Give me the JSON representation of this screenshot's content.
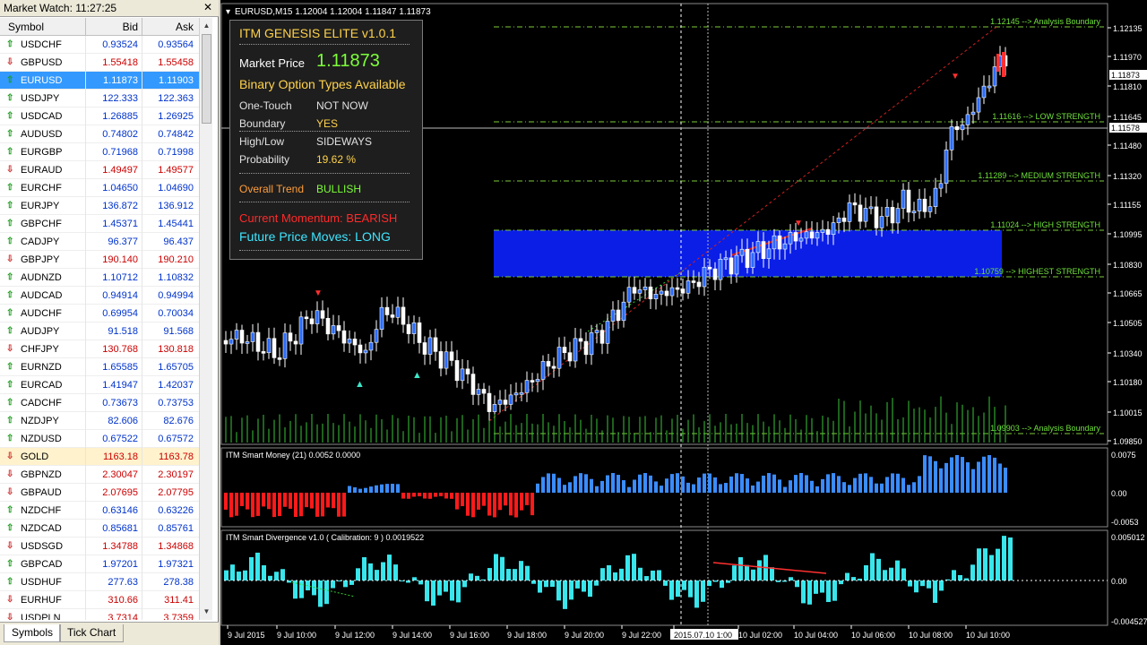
{
  "market_watch": {
    "title": "Market Watch: 11:27:25",
    "columns": [
      "Symbol",
      "Bid",
      "Ask"
    ],
    "rows": [
      {
        "symbol": "USDCHF",
        "bid": "0.93524",
        "ask": "0.93564",
        "dir": "up"
      },
      {
        "symbol": "GBPUSD",
        "bid": "1.55418",
        "ask": "1.55458",
        "dir": "down"
      },
      {
        "symbol": "EURUSD",
        "bid": "1.11873",
        "ask": "1.11903",
        "dir": "up",
        "selected": true
      },
      {
        "symbol": "USDJPY",
        "bid": "122.333",
        "ask": "122.363",
        "dir": "up"
      },
      {
        "symbol": "USDCAD",
        "bid": "1.26885",
        "ask": "1.26925",
        "dir": "up"
      },
      {
        "symbol": "AUDUSD",
        "bid": "0.74802",
        "ask": "0.74842",
        "dir": "up"
      },
      {
        "symbol": "EURGBP",
        "bid": "0.71968",
        "ask": "0.71998",
        "dir": "up"
      },
      {
        "symbol": "EURAUD",
        "bid": "1.49497",
        "ask": "1.49577",
        "dir": "down"
      },
      {
        "symbol": "EURCHF",
        "bid": "1.04650",
        "ask": "1.04690",
        "dir": "up"
      },
      {
        "symbol": "EURJPY",
        "bid": "136.872",
        "ask": "136.912",
        "dir": "up"
      },
      {
        "symbol": "GBPCHF",
        "bid": "1.45371",
        "ask": "1.45441",
        "dir": "up"
      },
      {
        "symbol": "CADJPY",
        "bid": "96.377",
        "ask": "96.437",
        "dir": "up"
      },
      {
        "symbol": "GBPJPY",
        "bid": "190.140",
        "ask": "190.210",
        "dir": "down"
      },
      {
        "symbol": "AUDNZD",
        "bid": "1.10712",
        "ask": "1.10832",
        "dir": "up"
      },
      {
        "symbol": "AUDCAD",
        "bid": "0.94914",
        "ask": "0.94994",
        "dir": "up"
      },
      {
        "symbol": "AUDCHF",
        "bid": "0.69954",
        "ask": "0.70034",
        "dir": "up"
      },
      {
        "symbol": "AUDJPY",
        "bid": "91.518",
        "ask": "91.568",
        "dir": "up"
      },
      {
        "symbol": "CHFJPY",
        "bid": "130.768",
        "ask": "130.818",
        "dir": "down"
      },
      {
        "symbol": "EURNZD",
        "bid": "1.65585",
        "ask": "1.65705",
        "dir": "up"
      },
      {
        "symbol": "EURCAD",
        "bid": "1.41947",
        "ask": "1.42037",
        "dir": "up"
      },
      {
        "symbol": "CADCHF",
        "bid": "0.73673",
        "ask": "0.73753",
        "dir": "up"
      },
      {
        "symbol": "NZDJPY",
        "bid": "82.606",
        "ask": "82.676",
        "dir": "up"
      },
      {
        "symbol": "NZDUSD",
        "bid": "0.67522",
        "ask": "0.67572",
        "dir": "up"
      },
      {
        "symbol": "GOLD",
        "bid": "1163.18",
        "ask": "1163.78",
        "dir": "down",
        "highlight": true
      },
      {
        "symbol": "GBPNZD",
        "bid": "2.30047",
        "ask": "2.30197",
        "dir": "down"
      },
      {
        "symbol": "GBPAUD",
        "bid": "2.07695",
        "ask": "2.07795",
        "dir": "down"
      },
      {
        "symbol": "NZDCHF",
        "bid": "0.63146",
        "ask": "0.63226",
        "dir": "up"
      },
      {
        "symbol": "NZDCAD",
        "bid": "0.85681",
        "ask": "0.85761",
        "dir": "up"
      },
      {
        "symbol": "USDSGD",
        "bid": "1.34788",
        "ask": "1.34868",
        "dir": "down"
      },
      {
        "symbol": "GBPCAD",
        "bid": "1.97201",
        "ask": "1.97321",
        "dir": "up"
      },
      {
        "symbol": "USDHUF",
        "bid": "277.63",
        "ask": "278.38",
        "dir": "up"
      },
      {
        "symbol": "EURHUF",
        "bid": "310.66",
        "ask": "311.41",
        "dir": "down"
      },
      {
        "symbol": "USDPLN",
        "bid": "3.7314",
        "ask": "3.7359",
        "dir": "down"
      }
    ],
    "tabs": [
      "Symbols",
      "Tick Chart"
    ]
  },
  "chart": {
    "header": "EURUSD,M15  1.12004 1.12004 1.11847 1.11873",
    "price_axis": [
      "1.12135",
      "1.11970",
      "1.11810",
      "1.11645",
      "1.11480",
      "1.11320",
      "1.11155",
      "1.10995",
      "1.10830",
      "1.10665",
      "1.10505",
      "1.10340",
      "1.10180",
      "1.10015",
      "1.09850"
    ],
    "price_tag_current": "1.11873",
    "price_tag_cross": "1.11578",
    "time_axis": [
      "9 Jul 2015",
      "9 Jul 10:00",
      "9 Jul 12:00",
      "9 Jul 14:00",
      "9 Jul 16:00",
      "9 Jul 18:00",
      "9 Jul 20:00",
      "9 Jul 22:00",
      "2015.07.10 1:00",
      "10 Jul 02:00",
      "10 Jul 04:00",
      "10 Jul 06:00",
      "10 Jul 08:00",
      "10 Jul 10:00"
    ],
    "levels": [
      {
        "label": "1.12145 --> Analysis Boundary"
      },
      {
        "label": "1.11616 --> LOW STRENGTH"
      },
      {
        "label": "1.11289 --> MEDIUM STRENGTH"
      },
      {
        "label": "1.11024 --> HIGH STRENGTH"
      },
      {
        "label": "1.10759 --> HIGHEST STRENGTH"
      },
      {
        "label": "1.09903 --> Analysis Boundary"
      }
    ],
    "sub1": {
      "title": "ITM Smart Money (21) 0.0052 0.0000",
      "axis": [
        "0.0075",
        "0.00",
        "-0.0053"
      ]
    },
    "sub2": {
      "title": "ITM Smart Divergence v1.0 ( Calibration: 9 ) 0.0019522",
      "axis": [
        "0.005012",
        "0.00",
        "-0.004527"
      ]
    }
  },
  "panel": {
    "title": "ITM GENESIS ELITE v1.0.1",
    "market_price_label": "Market Price",
    "market_price": "1.11873",
    "binary_heading": "Binary Option Types Available",
    "one_touch_label": "One-Touch",
    "one_touch_value": "NOT NOW",
    "boundary_label": "Boundary",
    "boundary_value": "YES",
    "highlow_label": "High/Low",
    "highlow_value": "SIDEWAYS",
    "probability_label": "Probability",
    "probability_value": "19.62 %",
    "trend_label": "Overall Trend",
    "trend_value": "BULLISH",
    "momentum": "Current Momentum: BEARISH",
    "future": "Future Price Moves: LONG"
  }
}
